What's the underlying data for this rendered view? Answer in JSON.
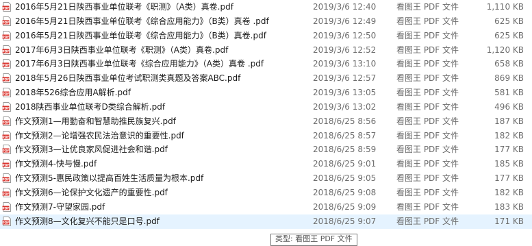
{
  "files": [
    {
      "name": "2016年5月21日陕西事业单位联考《职测》（A类）真卷.pdf",
      "date": "2019/3/6 12:40",
      "type": "看图王 PDF 文件",
      "size": "1,110 KB"
    },
    {
      "name": "2016年5月21日陕西事业单位联考《综合应用能力》（B类）真卷 .pdf",
      "date": "2019/3/6 12:49",
      "type": "看图王 PDF 文件",
      "size": "625 KB"
    },
    {
      "name": "2016年5月21日陕西事业单位联考《综合应用能力》（B类）真卷.pdf",
      "date": "2019/3/6 12:50",
      "type": "看图王 PDF 文件",
      "size": "625 KB"
    },
    {
      "name": "2017年6月3日陕西事业单位联考《职测》（A类）真卷.pdf",
      "date": "2019/3/6 12:52",
      "type": "看图王 PDF 文件",
      "size": "1,120 KB"
    },
    {
      "name": "2017年6月3日陕西事业单位联考《综合应用能力》（A类）真卷 .pdf",
      "date": "2019/3/6 13:10",
      "type": "看图王 PDF 文件",
      "size": "658 KB"
    },
    {
      "name": "2018年5月26日陕西事业单位考试职测类真题及答案ABC.pdf",
      "date": "2019/3/6 12:57",
      "type": "看图王 PDF 文件",
      "size": "869 KB"
    },
    {
      "name": "2018年526综合应用A解析.pdf",
      "date": "2019/3/6 13:05",
      "type": "看图王 PDF 文件",
      "size": "581 KB"
    },
    {
      "name": "2018陕西事业单位联考D类综合解析.pdf",
      "date": "2019/3/6 13:02",
      "type": "看图王 PDF 文件",
      "size": "496 KB"
    },
    {
      "name": "作文预测1—用勤奋和智慧助推民族复兴.pdf",
      "date": "2018/6/25 8:56",
      "type": "看图王 PDF 文件",
      "size": "187 KB"
    },
    {
      "name": "作文预测2—论增强农民法治意识的重要性.pdf",
      "date": "2018/6/25 8:57",
      "type": "看图王 PDF 文件",
      "size": "182 KB"
    },
    {
      "name": "作文预测3—让优良家风促进社会和谐.pdf",
      "date": "2018/6/25 8:59",
      "type": "看图王 PDF 文件",
      "size": "177 KB"
    },
    {
      "name": "作文预测4-快与慢.pdf",
      "date": "2018/6/25 9:01",
      "type": "看图王 PDF 文件",
      "size": "185 KB"
    },
    {
      "name": "作文预测5-惠民政策以提高百姓生活质量为根本.pdf",
      "date": "2018/6/25 9:05",
      "type": "看图王 PDF 文件",
      "size": "177 KB"
    },
    {
      "name": "作文预测6—论保护文化遗产的重要性.pdf",
      "date": "2018/6/25 9:08",
      "type": "看图王 PDF 文件",
      "size": "182 KB"
    },
    {
      "name": "作文预测7-守望家园.pdf",
      "date": "2018/6/25 9:09",
      "type": "看图王 PDF 文件",
      "size": "183 KB"
    },
    {
      "name": "作文预测8—文化复兴不能只是口号.pdf",
      "date": "2018/6/25 9:07",
      "type": "看图王 PDF 文件",
      "size": "171 KB"
    }
  ],
  "tooltip": {
    "text": "类型: 看图王 PDF 文件"
  },
  "colors": {
    "icon_red": "#d9312b",
    "hover_row": "#e5f3ff",
    "meta_text": "#6d6d6d"
  },
  "icon": "pdf-file-icon"
}
